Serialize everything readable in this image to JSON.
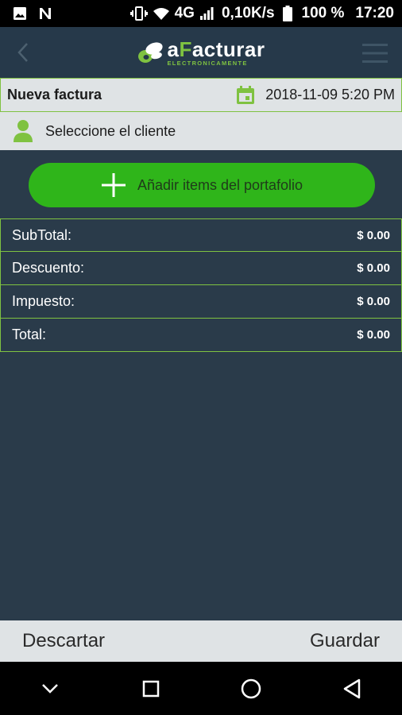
{
  "status_bar": {
    "network": "4G",
    "speed": "0,10K/s",
    "battery": "100 %",
    "time": "17:20"
  },
  "header": {
    "logo_prefix": "a",
    "logo_highlight": "F",
    "logo_rest": "acturar",
    "logo_tagline": "ELECTRONICAMENTE",
    "icons": [
      "back-arrow",
      "hamburger-menu"
    ]
  },
  "invoice": {
    "title": "Nueva factura",
    "datetime": "2018-11-09 5:20 PM"
  },
  "client": {
    "placeholder": "Seleccione el cliente"
  },
  "add_items": {
    "label": "Añadir items del portafolio"
  },
  "totals": [
    {
      "label": "SubTotal:",
      "value": "$ 0.00"
    },
    {
      "label": "Descuento:",
      "value": "$ 0.00"
    },
    {
      "label": "Impuesto:",
      "value": "$ 0.00"
    },
    {
      "label": "Total:",
      "value": "$ 0.00"
    }
  ],
  "actions": {
    "discard": "Descartar",
    "save": "Guardar"
  },
  "colors": {
    "background": "#2a3b4a",
    "accent_green": "#7fc241",
    "button_green": "#2fb51a",
    "panel_light": "#dfe3e5"
  }
}
